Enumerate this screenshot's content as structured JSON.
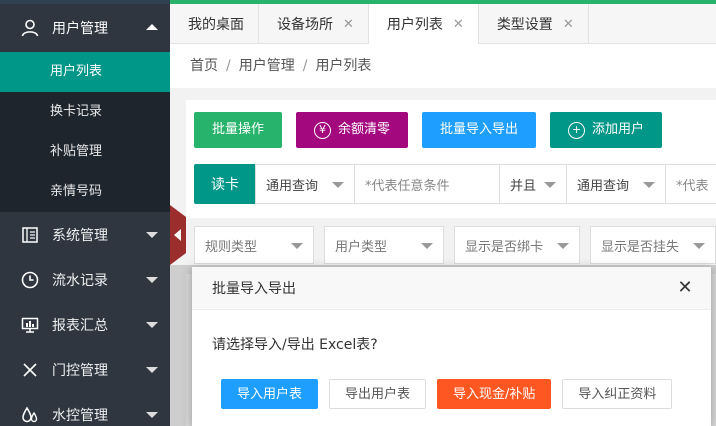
{
  "sidebar": {
    "user_mgmt": {
      "label": "用户管理",
      "icon": "user-icon"
    },
    "sub_items": [
      {
        "label": "用户列表",
        "active": true
      },
      {
        "label": "换卡记录",
        "active": false
      },
      {
        "label": "补贴管理",
        "active": false
      },
      {
        "label": "亲情号码",
        "active": false
      }
    ],
    "items": [
      {
        "label": "系统管理",
        "icon": "system-icon"
      },
      {
        "label": "流水记录",
        "icon": "clock-icon"
      },
      {
        "label": "报表汇总",
        "icon": "report-icon"
      },
      {
        "label": "门控管理",
        "icon": "close-x-icon"
      },
      {
        "label": "水控管理",
        "icon": "water-drops-icon"
      }
    ]
  },
  "tabs": [
    {
      "label": "我的桌面",
      "closable": false,
      "active": false
    },
    {
      "label": "设备场所",
      "closable": true,
      "active": false
    },
    {
      "label": "用户列表",
      "closable": true,
      "active": true
    },
    {
      "label": "类型设置",
      "closable": true,
      "active": false
    }
  ],
  "breadcrumb": [
    "首页",
    "用户管理",
    "用户列表"
  ],
  "toolbar": {
    "batch": "批量操作",
    "clear": "余额清零",
    "import_export": "批量导入导出",
    "add_user": "添加用户"
  },
  "query": {
    "read_card": "读卡",
    "mode1": "通用查询",
    "placeholder1": "*代表任意条件",
    "logic": "并且",
    "mode2": "通用查询",
    "placeholder2": "*代表"
  },
  "filters": [
    "规则类型",
    "用户类型",
    "显示是否绑卡",
    "显示是否挂失"
  ],
  "dialog": {
    "title": "批量导入导出",
    "message": "请选择导入/导出 Excel表?",
    "buttons": {
      "import_users": "导入用户表",
      "export_users": "导出用户表",
      "import_cash": "导入现金/补贴",
      "import_correct": "导入纠正资料"
    }
  },
  "colors": {
    "teal": "#009688",
    "green": "#27b36b",
    "magenta": "#a4087f",
    "blue": "#1e9fff",
    "orange": "#ff5722",
    "sidebar": "#2f3640"
  }
}
